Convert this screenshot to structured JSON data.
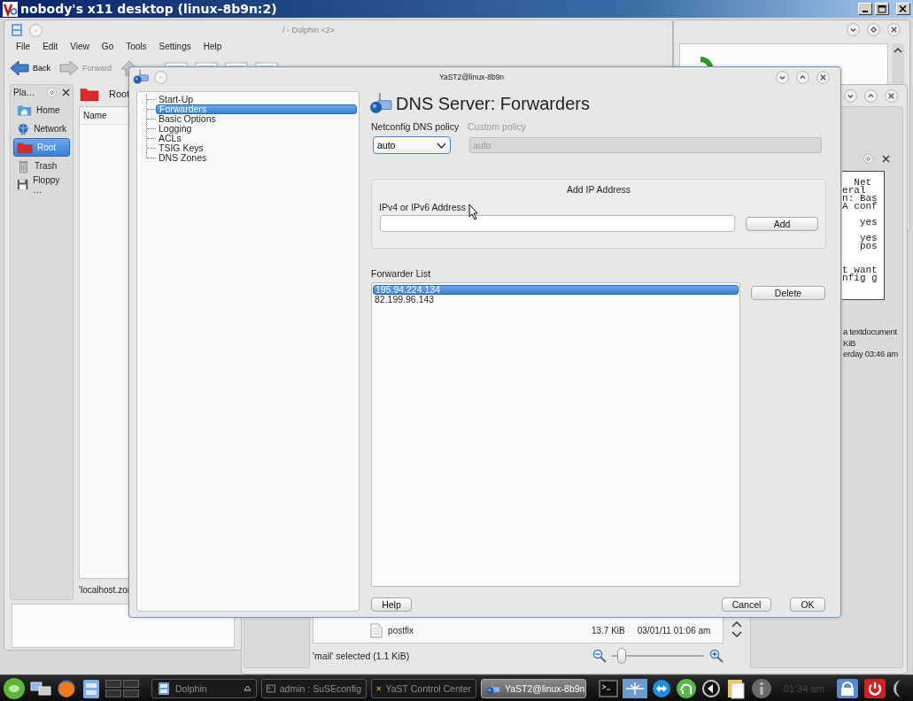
{
  "vnc_window": {
    "title": "nobody's x11 desktop (linux-8b9n:2)"
  },
  "dolphin_back": {
    "title": "/ - Dolphin <2>",
    "menu": [
      "File",
      "Edit",
      "View",
      "Go",
      "Tools",
      "Settings",
      "Help"
    ],
    "toolbar": [
      "Back",
      "Forward"
    ],
    "places": {
      "title": "Pla…",
      "items": [
        {
          "label": "Home",
          "selected": false
        },
        {
          "label": "Network",
          "selected": false
        },
        {
          "label": "Root",
          "selected": true
        },
        {
          "label": "Trash",
          "selected": false
        },
        {
          "label": "Floppy …",
          "selected": false
        }
      ]
    },
    "location": "Root",
    "column": "Name",
    "status": "'localhost.zor"
  },
  "dolphin_front": {
    "preview_lines": [
      {
        "kind": "text",
        "text": "  Net"
      },
      {
        "kind": "text",
        "text": "eral"
      },
      {
        "kind": "text",
        "text": "n: Bas"
      },
      {
        "kind": "text",
        "text": "A conf"
      },
      {
        "kind": "blank"
      },
      {
        "kind": "text",
        "text": "   yes"
      },
      {
        "kind": "blank"
      },
      {
        "kind": "text",
        "text": "   yes"
      },
      {
        "kind": "text",
        "text": "   pos"
      },
      {
        "kind": "blank"
      },
      {
        "kind": "blank"
      },
      {
        "kind": "text",
        "text": "t want"
      },
      {
        "kind": "text",
        "text": "nfig g"
      }
    ],
    "info": [
      "a textdocument",
      "KiB",
      "erday 03:46 am"
    ],
    "file": {
      "name": "postfix",
      "size": "13.7 KiB",
      "modified": "03/01/11 01:06 am"
    },
    "status": "'mail' selected (1.1 KiB)",
    "zoom": {
      "level": 0.05
    }
  },
  "yast": {
    "title": "YaST2@linux-8b9n",
    "tree": [
      {
        "label": "Start-Up",
        "selected": false
      },
      {
        "label": "Forwarders",
        "selected": true
      },
      {
        "label": "Basic Options",
        "selected": false
      },
      {
        "label": "Logging",
        "selected": false
      },
      {
        "label": "ACLs",
        "selected": false
      },
      {
        "label": "TSIG Keys",
        "selected": false
      },
      {
        "label": "DNS Zones",
        "selected": false
      }
    ],
    "heading": "DNS Server: Forwarders",
    "policy": {
      "label": "Netconfig DNS policy",
      "value": "auto"
    },
    "custom_policy": {
      "label": "Custom policy",
      "value": "auto",
      "disabled": true
    },
    "add_group": {
      "title": "Add IP Address",
      "field_label": "IPv4 or IPv6 Address",
      "button": "Add"
    },
    "forwarders": {
      "label": "Forwarder List",
      "items": [
        {
          "address": "195.94.224.134",
          "selected": true
        },
        {
          "address": "82.199.96.143",
          "selected": false
        }
      ],
      "button": "Delete"
    },
    "buttons": [
      {
        "label": "Help",
        "kind": "help"
      },
      {
        "label": "Cancel",
        "kind": "cancel"
      },
      {
        "label": "OK",
        "kind": "ok"
      }
    ]
  },
  "taskbar": {
    "tasks": [
      {
        "label": "Dolphin",
        "selected": false
      },
      {
        "label": "admin : SuSEconfig",
        "selected": false
      },
      {
        "label": "YaST Control Center",
        "selected": false
      },
      {
        "label": "YaST2@linux-8b9n",
        "selected": true
      }
    ],
    "clock": "01:34 am"
  }
}
